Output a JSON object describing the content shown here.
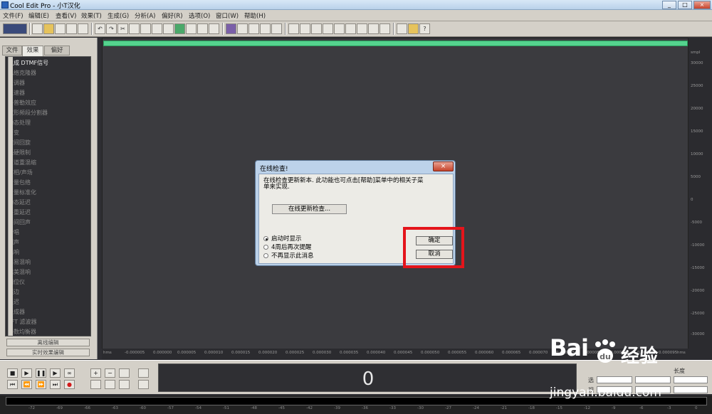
{
  "window": {
    "title": "Cool Edit Pro - 小T汉化",
    "minimize": "_",
    "maximize": "□",
    "close": "×"
  },
  "menu": [
    "文件(F)",
    "编辑(E)",
    "查看(V)",
    "效果(T)",
    "生成(G)",
    "分析(A)",
    "偏好(R)",
    "选项(O)",
    "窗口(W)",
    "帮助(H)"
  ],
  "panel": {
    "tabs": [
      "文件",
      "效果",
      "偏好"
    ],
    "active_tab": "效果",
    "effects": [
      "生成 DTMF信号",
      "包络克隆器",
      "变调器",
      "变速器",
      "多普勒效应",
      "波形频段分割器",
      "动态处理",
      "渐变",
      "空间回旋",
      "强硬限制",
      "声道重混缩",
      "声相/声场",
      "音量包络",
      "音量标准化",
      "动态延迟",
      "多重延迟",
      "房间回声",
      "合唱",
      "回声",
      "混响",
      "简易混响",
      "完美混响",
      "相位仪",
      "镶边",
      "延迟",
      "合成器",
      "FFT 滤波器",
      "参数均衡器"
    ],
    "btn_offline": "离线编辑",
    "btn_realtime": "实时效果编辑"
  },
  "ruler": {
    "h_unit": "hms",
    "h_ticks": [
      "-0.000005",
      "0.000000",
      "0.000005",
      "0.000010",
      "0.000015",
      "0.000020",
      "0.000025",
      "0.000030",
      "0.000035",
      "0.000040",
      "0.000045",
      "0.000050",
      "0.000055",
      "0.000060",
      "0.000065",
      "0.000070",
      "0.000075",
      "0.000080",
      "0.000085",
      "0.000090",
      "0.000095"
    ],
    "v_unit": "smpl",
    "v_ticks": [
      "30000",
      "25000",
      "20000",
      "15000",
      "10000",
      "5000",
      "0",
      "-5000",
      "-10000",
      "-15000",
      "-20000",
      "-25000",
      "-30000"
    ]
  },
  "time_display": "0",
  "right_labels": {
    "select": "选",
    "view": "视",
    "length": "长度"
  },
  "meter_ticks": [
    "-72",
    "-69",
    "-66",
    "-63",
    "-60",
    "-57",
    "-54",
    "-51",
    "-48",
    "-45",
    "-42",
    "-39",
    "-36",
    "-33",
    "-30",
    "-27",
    "-24",
    "-21",
    "-18",
    "-15",
    "-12",
    "-9",
    "-6",
    "-3",
    "0"
  ],
  "dialog": {
    "title": "在线检查!",
    "close": "×",
    "message": "在线检查更新新本. 此功能也可点击[帮助]菜单中的相关子菜单来实现.",
    "update_button": "在线更新检查...",
    "options": [
      "启动时显示",
      "4周后再次提醒",
      "不再显示此消息"
    ],
    "selected_option": "启动时显示",
    "ok": "确定",
    "cancel": "取消"
  },
  "highlight_color": "#e4141b",
  "watermark": {
    "bai": "Bai",
    "du": "du",
    "jingyan": "经验",
    "url": "jingyan.baidu.com"
  }
}
